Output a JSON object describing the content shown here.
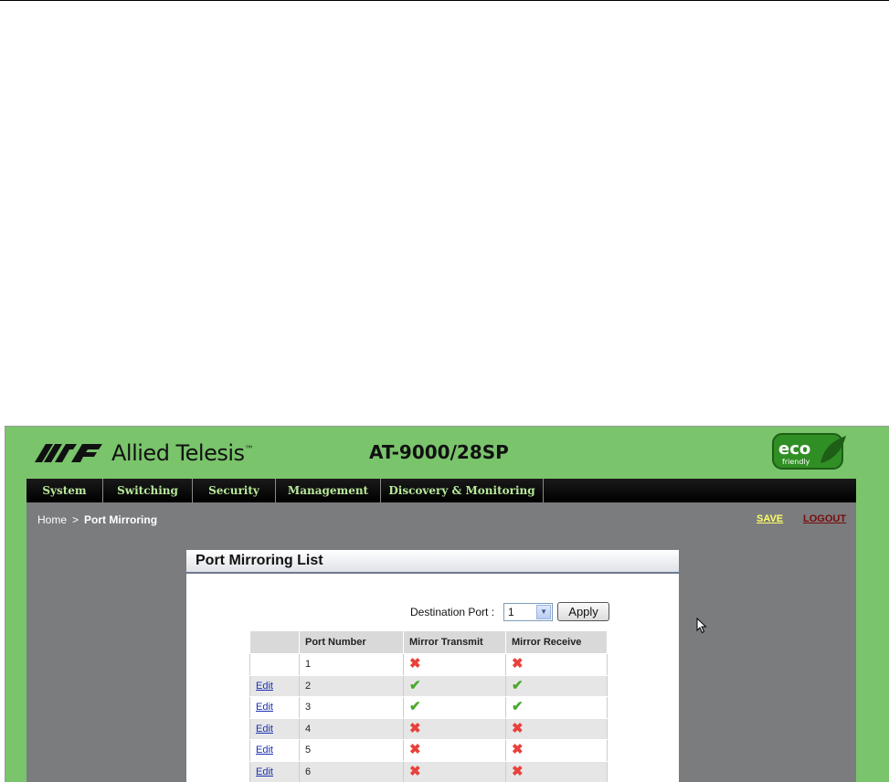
{
  "brand": {
    "logo_text": "Allied Telesis",
    "logo_tm": "™",
    "model": "AT-9000/28SP",
    "eco_badge": "eco",
    "eco_sub": "friendly"
  },
  "nav": [
    {
      "label": "System"
    },
    {
      "label": "Switching"
    },
    {
      "label": "Security"
    },
    {
      "label": "Management"
    },
    {
      "label": "Discovery & Monitoring"
    }
  ],
  "breadcrumb": {
    "home": "Home",
    "separator": ">",
    "current": "Port Mirroring"
  },
  "actions": {
    "save": "SAVE",
    "logout": "LOGOUT"
  },
  "panel": {
    "title": "Port Mirroring List",
    "destination_label": "Destination Port :",
    "destination_value": "1",
    "apply_label": "Apply"
  },
  "table": {
    "headers": [
      "",
      "Port Number",
      "Mirror Transmit",
      "Mirror Receive"
    ],
    "rows": [
      {
        "edit": "",
        "port": "1",
        "tx": "no",
        "rx": "no"
      },
      {
        "edit": "Edit",
        "port": "2",
        "tx": "yes",
        "rx": "yes"
      },
      {
        "edit": "Edit",
        "port": "3",
        "tx": "yes",
        "rx": "yes"
      },
      {
        "edit": "Edit",
        "port": "4",
        "tx": "no",
        "rx": "no"
      },
      {
        "edit": "Edit",
        "port": "5",
        "tx": "no",
        "rx": "no"
      },
      {
        "edit": "Edit",
        "port": "6",
        "tx": "no",
        "rx": "no"
      }
    ]
  },
  "colors": {
    "frame_green": "#7ac46c",
    "nav_text": "#b8e89a",
    "content_gray": "#7a7c7e",
    "yes_mark": "#4aa82e",
    "no_mark": "#e8413c"
  }
}
